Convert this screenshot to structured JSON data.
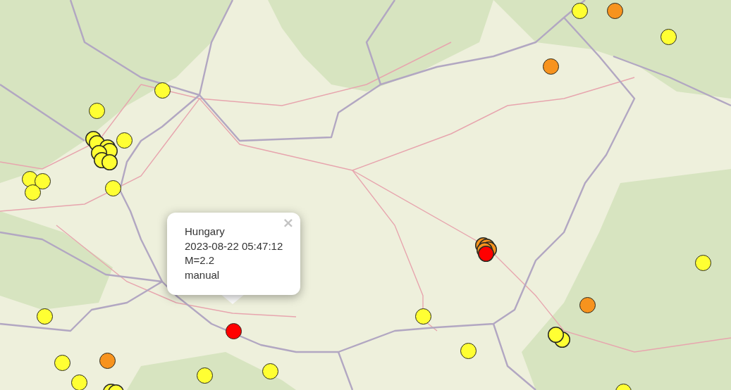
{
  "map": {
    "markers": [
      {
        "color": "#ffff33"
      },
      {
        "color": "#f7931e"
      },
      {
        "color": "#ffff33"
      },
      {
        "color": "#f7931e"
      },
      {
        "color": "#ffff33"
      },
      {
        "color": "#ffff33"
      },
      {
        "color": "#ffff33"
      },
      {
        "color": "#ffff33"
      },
      {
        "color": "#ffff33"
      },
      {
        "color": "#ffff33"
      },
      {
        "color": "#ffff33"
      },
      {
        "color": "#ffff33"
      },
      {
        "color": "#f7931e"
      },
      {
        "color": "#ffff33"
      },
      {
        "color": "#ffff33"
      },
      {
        "color": "#ff0000"
      },
      {
        "color": "#ffff33"
      },
      {
        "color": "#f7931e"
      },
      {
        "color": "#ffff33"
      },
      {
        "color": "#ffff33"
      },
      {
        "color": "#ffff33"
      },
      {
        "color": "#ffff33"
      },
      {
        "color": "#ffff33"
      }
    ],
    "clusters": [
      {
        "markers": [
          {
            "color": "#ffff33"
          },
          {
            "color": "#ffff33"
          },
          {
            "color": "#ffff33"
          },
          {
            "color": "#ffff33"
          },
          {
            "color": "#ffff33"
          },
          {
            "color": "#ffff33"
          },
          {
            "color": "#ffff33"
          }
        ]
      },
      {
        "markers": [
          {
            "color": "#f7931e"
          },
          {
            "color": "#f7931e"
          },
          {
            "color": "#f7931e"
          },
          {
            "color": "#f7931e"
          },
          {
            "color": "#ff0000"
          }
        ]
      },
      {
        "markers": [
          {
            "color": "#ffff33"
          },
          {
            "color": "#ffff33"
          }
        ]
      },
      {
        "markers": [
          {
            "color": "#ffff33"
          },
          {
            "color": "#ffff33"
          }
        ]
      }
    ]
  },
  "popup": {
    "region": "Hungary",
    "time": "2023-08-22 05:47:12",
    "magnitude": "M=2.2",
    "status": "manual",
    "close": "×"
  }
}
